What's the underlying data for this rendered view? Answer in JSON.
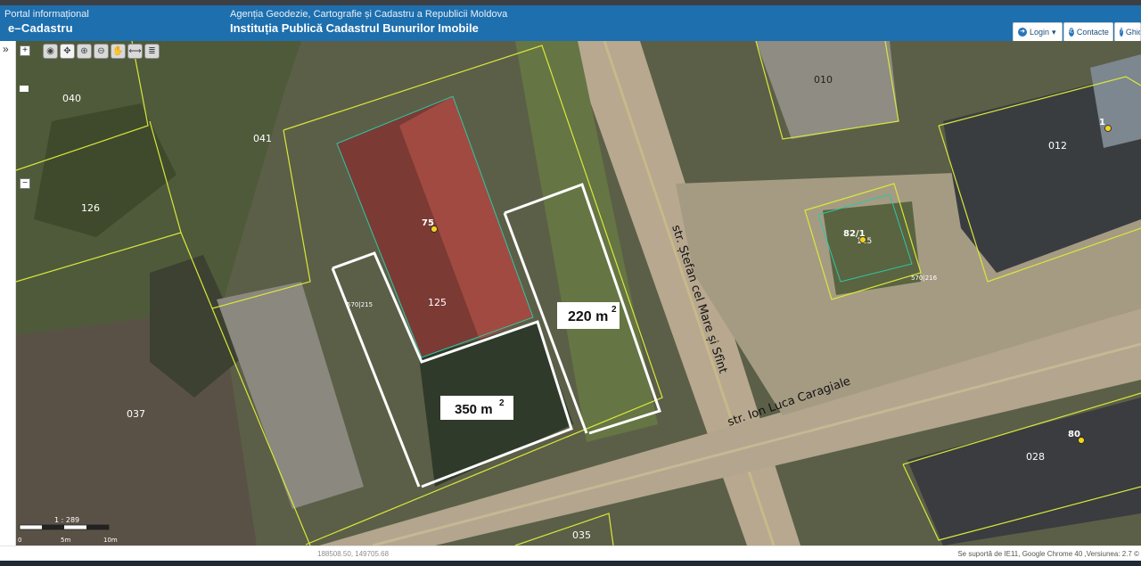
{
  "header": {
    "portal_label": "Portal informațional",
    "app_name": "e–Cadastru",
    "agency": "Agenția Geodezie, Cartografie și Cadastru a Republicii Moldova",
    "institution": "Instituția Publică Cadastrul Bunurilor Imobile",
    "login_label": "Login",
    "contacts_label": "Contacte",
    "guide_label": "Ghid"
  },
  "sidebar": {
    "toggle_icon": "»"
  },
  "map_controls": {
    "zoom_in": "+",
    "zoom_out": "−",
    "slider": "▬"
  },
  "toolbar": {
    "tools": [
      "globe-icon",
      "pan-icon",
      "zoom-in-icon",
      "zoom-out-icon",
      "hand-icon",
      "measure-icon",
      "layers-icon"
    ]
  },
  "map": {
    "parcels": {
      "p040": "040",
      "p041": "041",
      "p126": "126",
      "p037": "037",
      "p125": "125",
      "p035": "035",
      "p010": "010",
      "p012": "012",
      "p028": "028",
      "p125b": "125"
    },
    "cadastral_codes": {
      "c1": "570|215",
      "c2": "570|216"
    },
    "points": {
      "n75": "75",
      "n82": "82/1",
      "n1": "1",
      "n80": "80",
      "n1b": "1"
    },
    "areas": {
      "area1_value": "220 m",
      "area1_exp": "2",
      "area2_value": "350 m",
      "area2_exp": "2"
    },
    "streets": {
      "s1": "str. Ștefan cel Mare și Sfînt",
      "s2": "str. Ion Luca Caragiale"
    },
    "scale": {
      "ratio": "1 : 289",
      "t0": "0",
      "t5": "5m",
      "t10": "10m"
    }
  },
  "status": {
    "coordinates": "188508.50, 149705.68",
    "support": "Se suportă de IE11, Google Chrome 40 ,Versiunea: 2.7 ©"
  }
}
